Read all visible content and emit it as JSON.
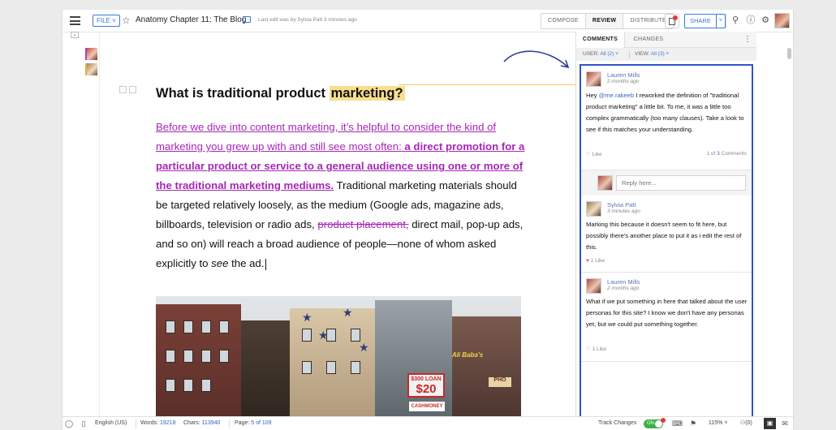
{
  "topbar": {
    "file_label": "FILE ˅",
    "doc_title": "Anatomy Chapter 11: The Blog",
    "last_edit": "Last edit was by Sylvia Patt 3 minutes ago",
    "modes": [
      "COMPOSE",
      "REVIEW",
      "DISTRIBUTE"
    ],
    "active_mode": "REVIEW",
    "share_label": "SHARE",
    "share_caret": "˅"
  },
  "document": {
    "heading_plain": "What is traditional product ",
    "heading_highlight": "marketing?",
    "para_ins_1": "Before we dive into content marketing, it’s helpful to consider the kind of marketing you grew up with and still see most often: ",
    "para_ins_bold": "a direct promotion for a particular product or service to a general audience using one or more of the traditional marketing mediums.",
    "para_plain_1": " Traditional marketing materials should be targeted relatively loosely, as the medium (Google ads, magazine ads, billboards, television or radio ads, ",
    "para_del": "product placement,",
    "para_plain_2": " direct mail, pop-up ads, and so on) will reach a broad audience of people—none of whom asked explicitly to ",
    "para_em": "see",
    "para_plain_3": " the ad."
  },
  "photo_signs": {
    "loan_top": "$300 LOAN",
    "loan_big": "$20",
    "alibaba": "Ali Baba's",
    "pho": "PHO",
    "cash": "CASHMONEY"
  },
  "comments_panel": {
    "tabs": [
      "COMMENTS",
      "CHANGES"
    ],
    "active_tab": "COMMENTS",
    "filter_user_label": "USER:",
    "filter_user_value": "All (2) ˅",
    "filter_view_label": "VIEW:",
    "filter_view_value": "All (3) ˅",
    "comments": [
      {
        "author": "Lauren Mills",
        "time": "2 months ago",
        "text_pre": "Hey ",
        "mention": "@me.rakeeb",
        "text_post": " I reworked the definition of \"traditional product marketing\" a little bit. To me, it was a little too complex grammatically (too many clauses). Take a look to see if this matches your understanding.",
        "like_label": "Like",
        "count_pre": "1 of ",
        "count_num": "3",
        "count_post": " Comments"
      },
      {
        "author": "Sylvia Patt",
        "time": "3 minutes ago",
        "text": "Marking this because it doesn't seem to fit here, but possibly there's another place to put it as i edit the rest of this.",
        "like_label": "1 Like"
      },
      {
        "author": "Lauren Mills",
        "time": "2 months ago",
        "text": "What if we put something in here that talked about the user personas for this site? I know we don't have any personas yet, but we could put something together.",
        "like_label": "1 Like"
      }
    ],
    "reply_placeholder": "Reply here..."
  },
  "statusbar": {
    "language": "English (US)",
    "words_label": "Words:",
    "words_value": "19218",
    "chars_label": "Chars:",
    "chars_value": "113940",
    "page_label": "Page:",
    "page_value": "5",
    "page_of": "of 109",
    "track_label": "Track Changes",
    "toggle_label": "ON",
    "zoom": "115%",
    "zoom_caret": "˅",
    "collab_count": "(0)"
  },
  "colors": {
    "accent": "#3a7bd5",
    "tracked_change": "#a627b6",
    "comment_highlight": "#f9df8c",
    "active_comments_border": "#2f54c7",
    "toggle_on": "#3bb04a"
  },
  "icons": {
    "menu": "hamburger-icon",
    "star": "star-icon",
    "folder": "folder-icon",
    "notifications": "document-alert-icon",
    "user": "user-search-icon",
    "info": "info-icon",
    "settings": "gear-icon",
    "comment": "comment-icon",
    "arrow": "curved-arrow-icon"
  }
}
